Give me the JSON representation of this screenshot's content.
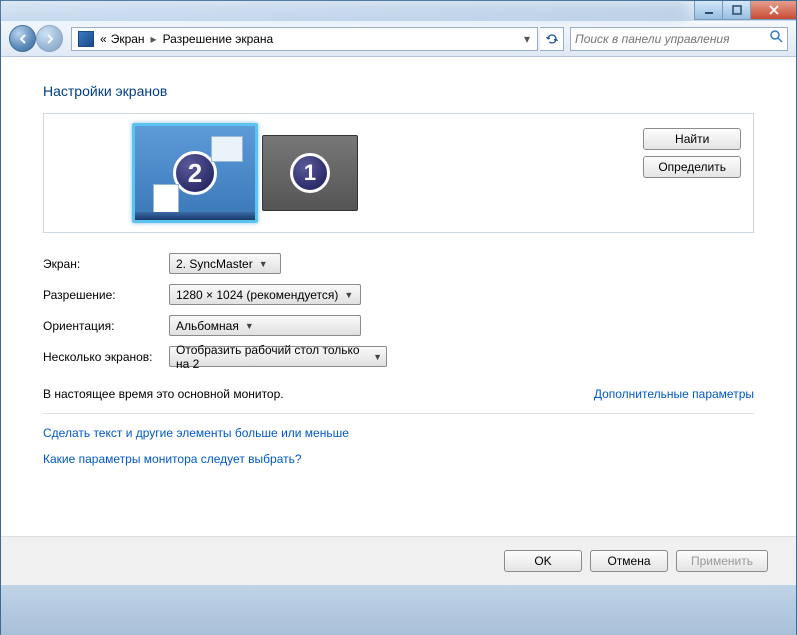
{
  "titlebar": {
    "min_icon": "minimize-icon",
    "max_icon": "maximize-icon",
    "close_icon": "close-icon"
  },
  "nav": {
    "breadcrumb_prefix": "«",
    "breadcrumb_1": "Экран",
    "breadcrumb_2": "Разрешение экрана",
    "search_placeholder": "Поиск в панели управления"
  },
  "page": {
    "title": "Настройки экранов",
    "find_btn": "Найти",
    "detect_btn": "Определить",
    "monitor_2_num": "2",
    "monitor_1_num": "1"
  },
  "form": {
    "display_label": "Экран:",
    "display_value": "2. SyncMaster",
    "resolution_label": "Разрешение:",
    "resolution_value": "1280 × 1024 (рекомендуется)",
    "orientation_label": "Ориентация:",
    "orientation_value": "Альбомная",
    "multi_label": "Несколько экранов:",
    "multi_value": "Отобразить рабочий стол только на 2"
  },
  "status": {
    "primary_text": "В настоящее время это основной монитор.",
    "adv_link": "Дополнительные параметры"
  },
  "links": {
    "text_size": "Сделать текст и другие элементы больше или меньше",
    "which_settings": "Какие параметры монитора следует выбрать?"
  },
  "footer": {
    "ok": "OK",
    "cancel": "Отмена",
    "apply": "Применить"
  }
}
